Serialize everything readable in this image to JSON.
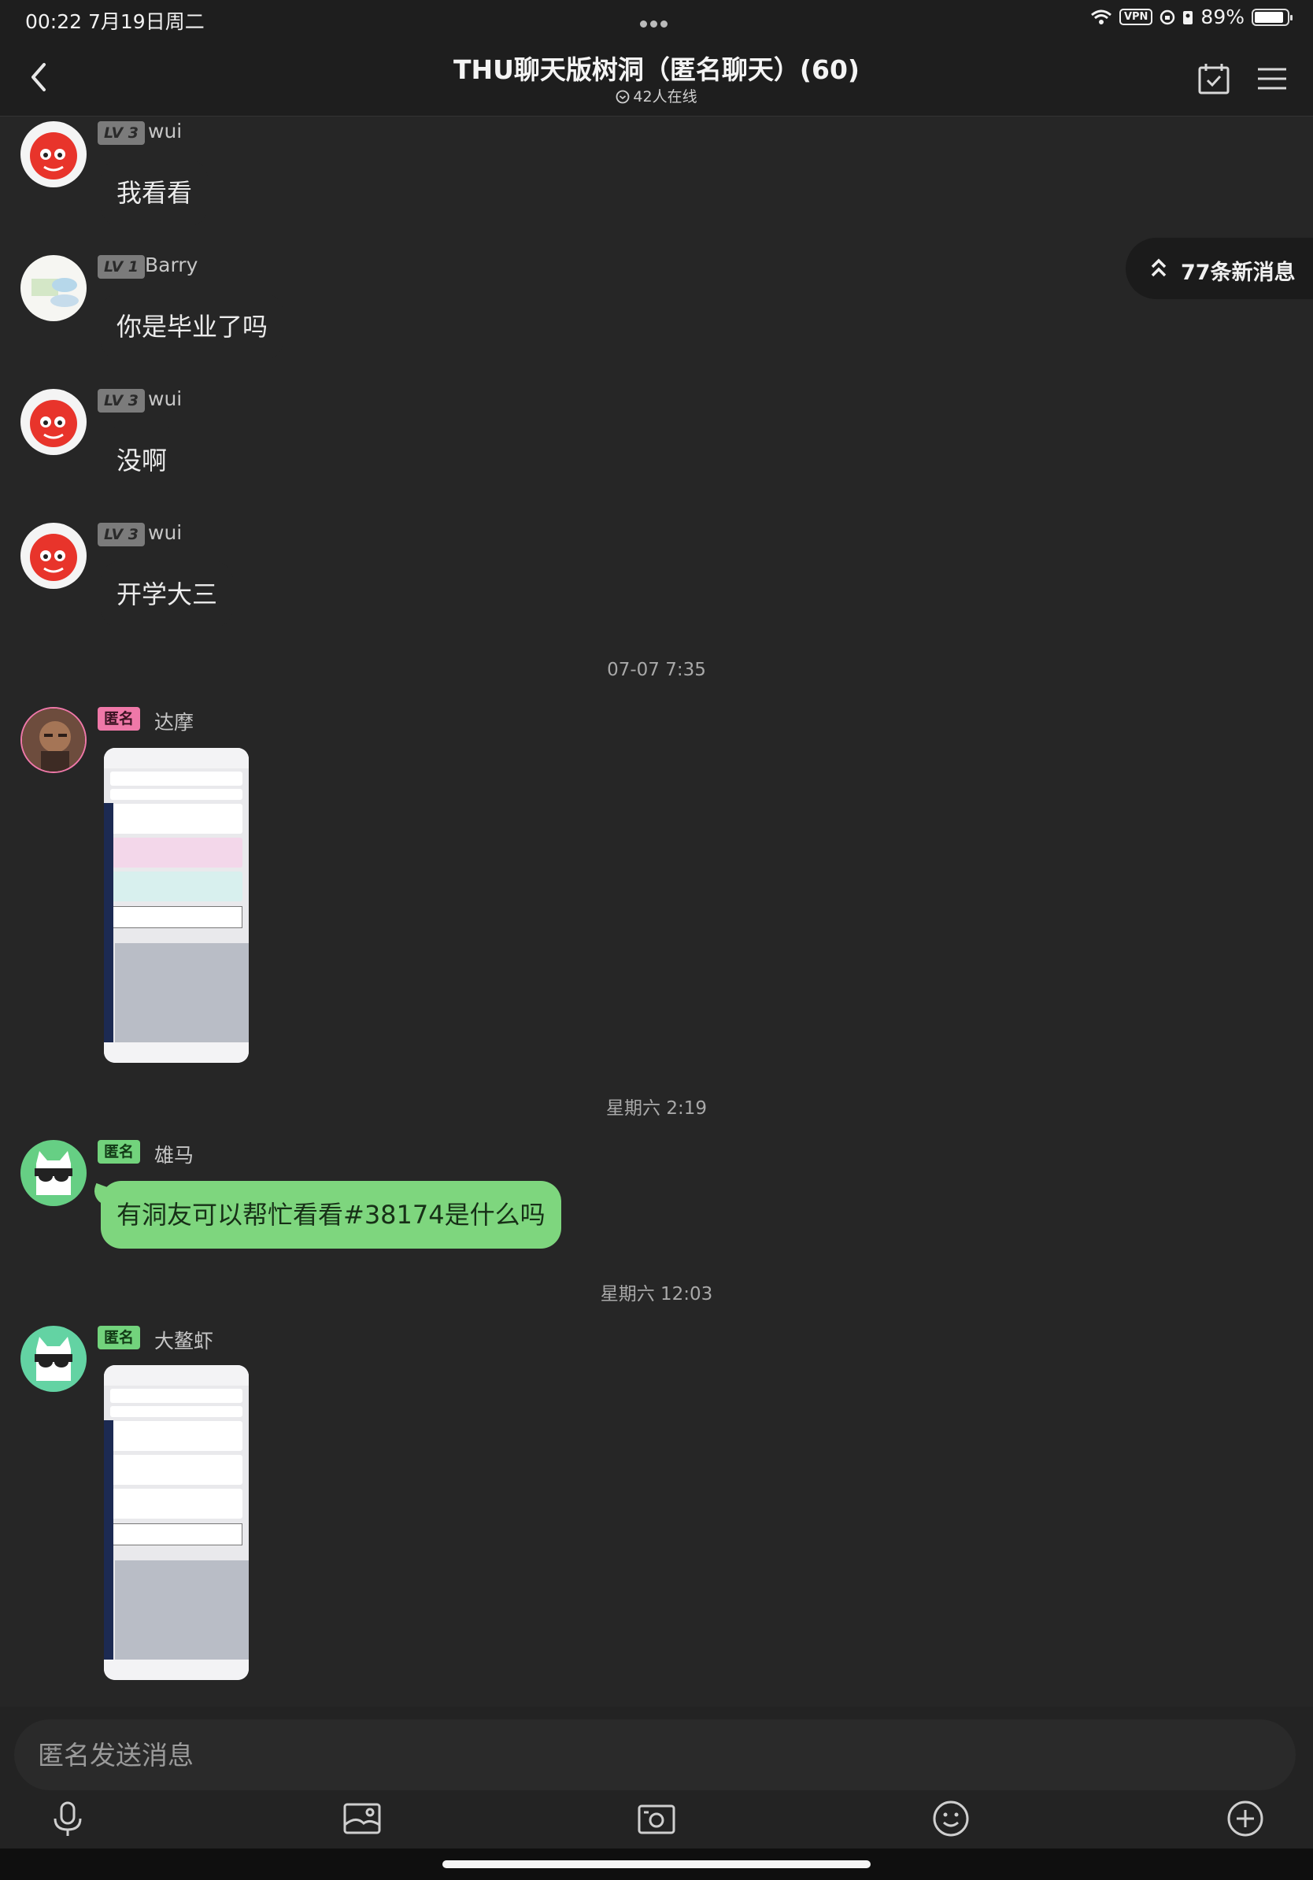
{
  "status_bar": {
    "time": "00:22  7月19日周二",
    "vpn": "VPN",
    "battery": "89%",
    "battery_level": 0.89
  },
  "header": {
    "title": "THU聊天版树洞（匿名聊天）(60)",
    "online": "42人在线",
    "icons": [
      "back-chevron",
      "calendar-check-icon",
      "menu-icon"
    ]
  },
  "new_messages": {
    "label": "77条新消息"
  },
  "messages": [
    {
      "badge": "LV 3",
      "name": "wui",
      "text": "我看看"
    },
    {
      "badge": "LV 1",
      "name": "Barry",
      "text": "你是毕业了吗"
    },
    {
      "badge": "LV 3",
      "name": "wui",
      "text": "没啊"
    },
    {
      "badge": "LV 3",
      "name": "wui",
      "text": "开学大三"
    },
    {
      "timestamp": "07-07 7:35"
    },
    {
      "badge": "匿名",
      "name": "达摩",
      "image": "screenshot"
    },
    {
      "timestamp": "星期六 2:19"
    },
    {
      "badge": "匿名",
      "name": "雄马",
      "text": "有洞友可以帮忙看看#38174是什么吗"
    },
    {
      "timestamp": "星期六 12:03"
    },
    {
      "badge": "匿名",
      "name": "大鳌虾",
      "image": "screenshot"
    }
  ],
  "composer": {
    "placeholder": "匿名发送消息",
    "tools": [
      "microphone-icon",
      "image-icon",
      "camera-icon",
      "emoji-icon",
      "plus-icon"
    ]
  },
  "colors": {
    "background": "#262626",
    "anon_pink": "#ef78a8",
    "anon_green": "#72d37c",
    "bubble_green": "#7ed67e"
  }
}
